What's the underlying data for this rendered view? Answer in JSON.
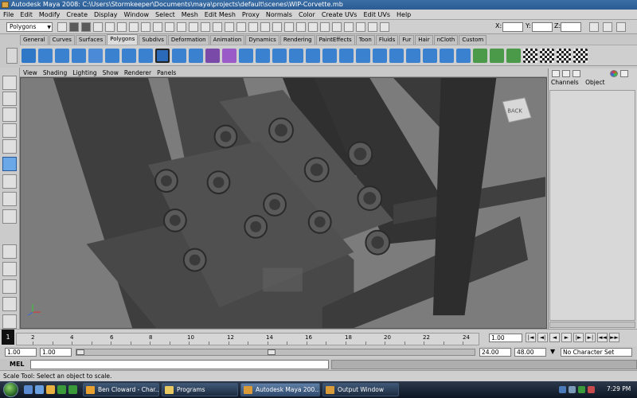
{
  "window": {
    "title": "Autodesk Maya 2008: C:\\Users\\Stormkeeper\\Documents\\maya\\projects\\default\\scenes\\WIP-Corvette.mb"
  },
  "menubar": [
    "File",
    "Edit",
    "Modify",
    "Create",
    "Display",
    "Window",
    "Select",
    "Mesh",
    "Edit Mesh",
    "Proxy",
    "Normals",
    "Color",
    "Create UVs",
    "Edit UVs",
    "Help"
  ],
  "statusline": {
    "mode": "Polygons",
    "coord_labels": [
      "X:",
      "Y:",
      "Z:"
    ]
  },
  "shelf": {
    "tabs": [
      "General",
      "Curves",
      "Surfaces",
      "Polygons",
      "Subdivs",
      "Deformation",
      "Animation",
      "Dynamics",
      "Rendering",
      "PaintEffects",
      "Toon",
      "Fluids",
      "Fur",
      "Hair",
      "nCloth",
      "Custom"
    ],
    "active_tab": "Polygons"
  },
  "panel_menu": [
    "View",
    "Shading",
    "Lighting",
    "Show",
    "Renderer",
    "Panels"
  ],
  "viewcube": {
    "label": "BACK"
  },
  "axis": {
    "x": "x",
    "y": "y",
    "z": "z"
  },
  "channel_box": {
    "headers": [
      "Channels",
      "Object"
    ]
  },
  "timeslider": {
    "ticks": [
      "2",
      "4",
      "6",
      "8",
      "10",
      "12",
      "14",
      "16",
      "18",
      "20",
      "22",
      "24"
    ],
    "current_frame": "1",
    "current_field": "1.00"
  },
  "playback": [
    "|◄",
    "◄|",
    "◄",
    "►",
    "|►",
    "►|",
    "◄◄",
    "►►"
  ],
  "rangeslider": {
    "start": "1.00",
    "start_inner": "1.00",
    "end_inner": "24.00",
    "end": "48.00",
    "character_set": "No Character Set"
  },
  "cmdline": {
    "label": "MEL"
  },
  "helpline": {
    "text": "Scale Tool: Select an object to scale."
  },
  "taskbar": {
    "tasks": [
      {
        "label": "Ben Cloward - Char...",
        "icon_color": "#e8a030"
      },
      {
        "label": "Programs",
        "icon_color": "#e8c860"
      },
      {
        "label": "Autodesk Maya 200...",
        "icon_color": "#d99a3a",
        "active": true
      },
      {
        "label": "Output Window",
        "icon_color": "#d99a3a"
      }
    ],
    "clock": "7:29 PM"
  }
}
